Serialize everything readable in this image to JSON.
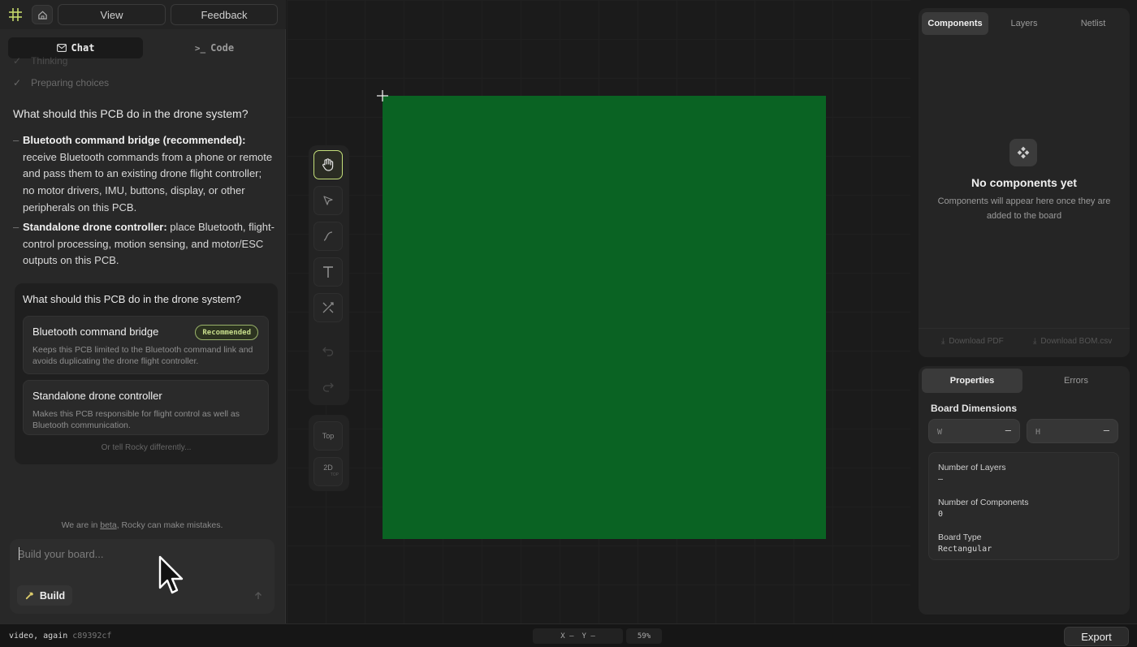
{
  "topbar": {
    "logo": "grid-logo-icon",
    "home_icon": "home-icon",
    "view_label": "View",
    "feedback_label": "Feedback"
  },
  "tabs": {
    "chat_label": "Chat",
    "chat_icon": "mail-icon",
    "code_label": "Code",
    "code_icon": "terminal-icon"
  },
  "progress": {
    "thinking": "Thinking",
    "preparing": "Preparing choices"
  },
  "message": {
    "question": "What should this PCB do in the drone system?",
    "bullets": [
      {
        "title": "Bluetooth command bridge (recommended):",
        "text": " receive Bluetooth commands from a phone or remote and pass them to an existing drone flight controller; no motor drivers, IMU, buttons, display, or other peripherals on this PCB."
      },
      {
        "title": "Standalone drone controller:",
        "text": " place Bluetooth, flight-control processing, motion sensing, and motor/ESC outputs on this PCB."
      }
    ]
  },
  "choice_card": {
    "question": "What should this PCB do in the drone system?",
    "options": [
      {
        "title": "Bluetooth command bridge",
        "badge": "Recommended",
        "desc": "Keeps this PCB limited to the Bluetooth command link and avoids duplicating the drone flight controller."
      },
      {
        "title": "Standalone drone controller",
        "badge": "",
        "desc": "Makes this PCB responsible for flight control as well as Bluetooth communication."
      }
    ],
    "alt_text": "Or tell Rocky differently..."
  },
  "beta": {
    "prefix": "We are in ",
    "link": "beta",
    "suffix": ", Rocky can make mistakes."
  },
  "composer": {
    "placeholder": "Build your board...",
    "build_label": "Build",
    "send_icon": "arrow-up-icon"
  },
  "toolbar": {
    "tools": [
      "hand-icon",
      "pointer-icon",
      "route-icon",
      "text-icon",
      "autoroute-icon",
      "undo-icon",
      "redo-icon"
    ],
    "layer_label": "Top",
    "view_label": "2D",
    "view_sub": "TOP"
  },
  "board": {
    "color": "#0a6323"
  },
  "right_top": {
    "tabs": [
      "Components",
      "Layers",
      "Netlist"
    ],
    "active_tab": "Components",
    "empty_title": "No components yet",
    "empty_desc": "Components will appear here once they are added to the board",
    "download_pdf": "Download PDF",
    "download_bom": "Download BOM.csv"
  },
  "right_bottom": {
    "tabs": [
      "Properties",
      "Errors"
    ],
    "active_tab": "Properties",
    "dim_title": "Board Dimensions",
    "w_placeholder": "W",
    "h_placeholder": "H",
    "w_suffix": "–",
    "h_suffix": "–",
    "props": [
      {
        "label": "Number of Layers",
        "value": "–"
      },
      {
        "label": "Number of Components",
        "value": "0"
      },
      {
        "label": "Board Type",
        "value": "Rectangular"
      }
    ]
  },
  "status": {
    "commit_msg": "video, again",
    "commit_hash": "c89392cf",
    "x_label": "X",
    "x_val": "–",
    "y_label": "Y",
    "y_val": "–",
    "zoom": "59%",
    "export_label": "Export"
  },
  "colors": {
    "accent": "#c5e07a",
    "board": "#0a6323"
  }
}
